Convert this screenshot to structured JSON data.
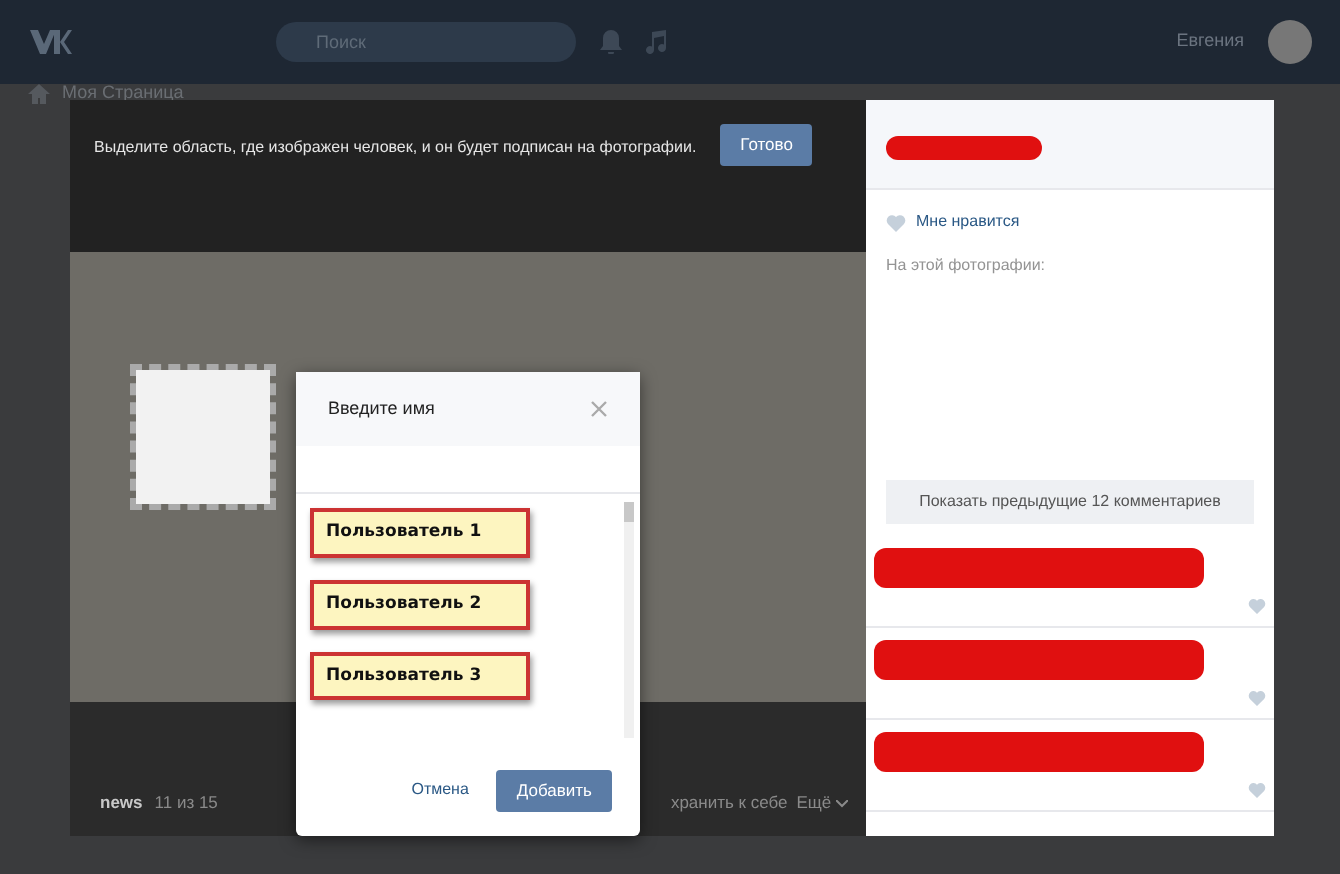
{
  "topbar": {
    "search_placeholder": "Поиск",
    "user_name": "Евгения"
  },
  "sidebar": {
    "items": [
      {
        "label": "Моя Страница"
      }
    ]
  },
  "viewer": {
    "instruction": "Выделите область, где изображен человек, и он будет подписан на фотографии.",
    "done_button": "Готово",
    "album": "news",
    "counter": "11 из 15",
    "actions": [
      {
        "label": "хранить к себе",
        "kind": "link"
      },
      {
        "label": "Ещё",
        "kind": "menu"
      }
    ]
  },
  "side_panel": {
    "like_label": "Мне нравится",
    "on_photo_label": "На этой фотографии:",
    "show_previous": "Показать предыдущие 12 комментариев",
    "comments": [
      {
        "redacted": true
      },
      {
        "redacted": true
      },
      {
        "redacted": true
      }
    ]
  },
  "dialog": {
    "title": "Введите имя",
    "users": [
      {
        "label": "Пользователь 1"
      },
      {
        "label": "Пользователь 2"
      },
      {
        "label": "Пользователь 3"
      }
    ],
    "cancel": "Отмена",
    "add": "Добавить"
  }
}
